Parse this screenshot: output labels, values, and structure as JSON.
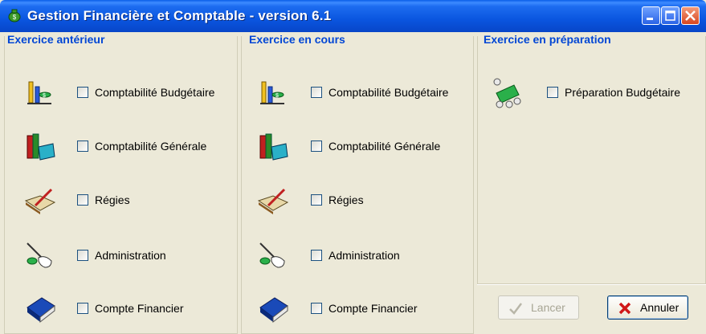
{
  "window": {
    "title": "Gestion Financière et Comptable - version 6.1"
  },
  "panels": [
    {
      "title": "Exercice antérieur",
      "items": [
        {
          "label": "Comptabilité Budgétaire",
          "icon": "budget-scale-icon"
        },
        {
          "label": "Comptabilité Générale",
          "icon": "books-icon"
        },
        {
          "label": "Régies",
          "icon": "ledger-pen-icon"
        },
        {
          "label": "Administration",
          "icon": "hand-pointer-icon"
        },
        {
          "label": "Compte Financier",
          "icon": "blue-book-icon"
        }
      ]
    },
    {
      "title": "Exercice en cours",
      "items": [
        {
          "label": "Comptabilité Budgétaire",
          "icon": "budget-scale-icon"
        },
        {
          "label": "Comptabilité Générale",
          "icon": "books-icon"
        },
        {
          "label": "Régies",
          "icon": "ledger-pen-icon"
        },
        {
          "label": "Administration",
          "icon": "hand-pointer-icon"
        },
        {
          "label": "Compte Financier",
          "icon": "blue-book-icon"
        }
      ]
    },
    {
      "title": "Exercice en préparation",
      "items": [
        {
          "label": "Préparation Budgétaire",
          "icon": "money-coins-icon"
        }
      ]
    }
  ],
  "buttons": {
    "launch": "Lancer",
    "cancel": "Annuler"
  },
  "colors": {
    "titlebar": "#0a56e0",
    "panel_title": "#0046d5",
    "window_bg": "#ece9d8"
  }
}
